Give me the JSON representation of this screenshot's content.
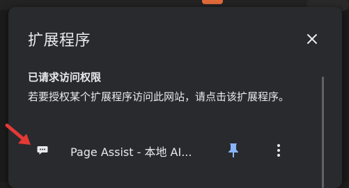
{
  "popup": {
    "title": "扩展程序",
    "close_icon": "close-icon",
    "section_heading": "已请求访问权限",
    "description": "若要授权某个扩展程序访问此网站，请点击该扩展程序。"
  },
  "extensions": [
    {
      "name": "Page Assist - 本地 AI...",
      "icon": "chat-bubble-icon",
      "pinned": true
    }
  ],
  "colors": {
    "panel_bg": "#292a2d",
    "text": "#e8eaed",
    "pin_accent": "#8ab4f8",
    "annotation_arrow": "#e53935"
  }
}
